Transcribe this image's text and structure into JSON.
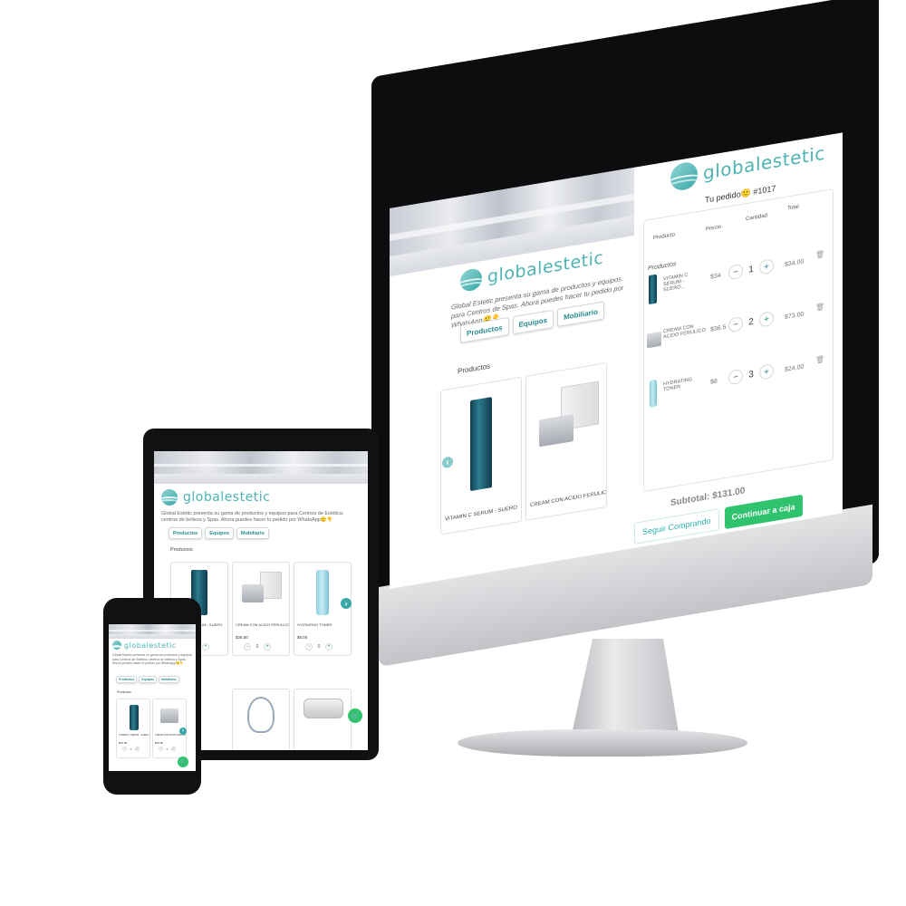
{
  "brand": {
    "name": "globalestetic",
    "accent": "#3ba7a9",
    "green": "#2fc36d"
  },
  "intro": {
    "desktop": "Global Estetic presenta su gama de productos y equipos para Centros de Spas. Ahora puedes hacer tu pedido por WhatsApp🙂👇",
    "tablet": "Global Estetic presenta su gama de productos y equipos para Centros de Estética, centros de belleza y Spas. Ahora puedes hacer tu pedido por WhatsApp🙂👇",
    "phone": "Global Estetic presenta su gama de productos y equipos para Centros de Estética, centros de belleza y Spas. Ahora puedes hacer tu pedido por WhatsApp🙂👇"
  },
  "tabs": [
    "Productos",
    "Equipos",
    "Mobiliario"
  ],
  "section_title": "Productos",
  "products": [
    {
      "name": "VITAMIN C SERUM - SUERO",
      "price": "$34.00",
      "qty": "0",
      "icon": "serum-bottle"
    },
    {
      "name": "CREAM CON ACIDO FERULICO",
      "price": "$36.50",
      "qty": "0",
      "icon": "cream-jar"
    },
    {
      "name": "HYDRATING TONER",
      "price": "$5.00",
      "qty": "0",
      "icon": "toner-spray"
    }
  ],
  "equipment_icons": [
    "led-mask",
    "magnifier-lamp",
    "device-console"
  ],
  "cart": {
    "title": "Tu pedido🙂 #1017",
    "headers": [
      "Producto",
      "Precio",
      "Cantidad",
      "Total"
    ],
    "group": "Productos",
    "items": [
      {
        "name": "VITAMIN C SERUM - SUERO...",
        "price": "$34",
        "qty": "1",
        "total": "$34.00"
      },
      {
        "name": "CREAM CON ACIDO FERULICO",
        "price": "$36.5",
        "qty": "2",
        "total": "$73.00"
      },
      {
        "name": "HYDRATING TONER",
        "price": "$8",
        "qty": "3",
        "total": "$24.00"
      }
    ],
    "subtotal": "Subtotal: $131.00",
    "continue_shopping": "Seguir Comprando",
    "checkout": "Continuar a caja"
  },
  "icons": {
    "minus": "−",
    "plus": "+",
    "trash": "🗑",
    "cart": "🛒",
    "next": "›",
    "prev": "‹"
  }
}
